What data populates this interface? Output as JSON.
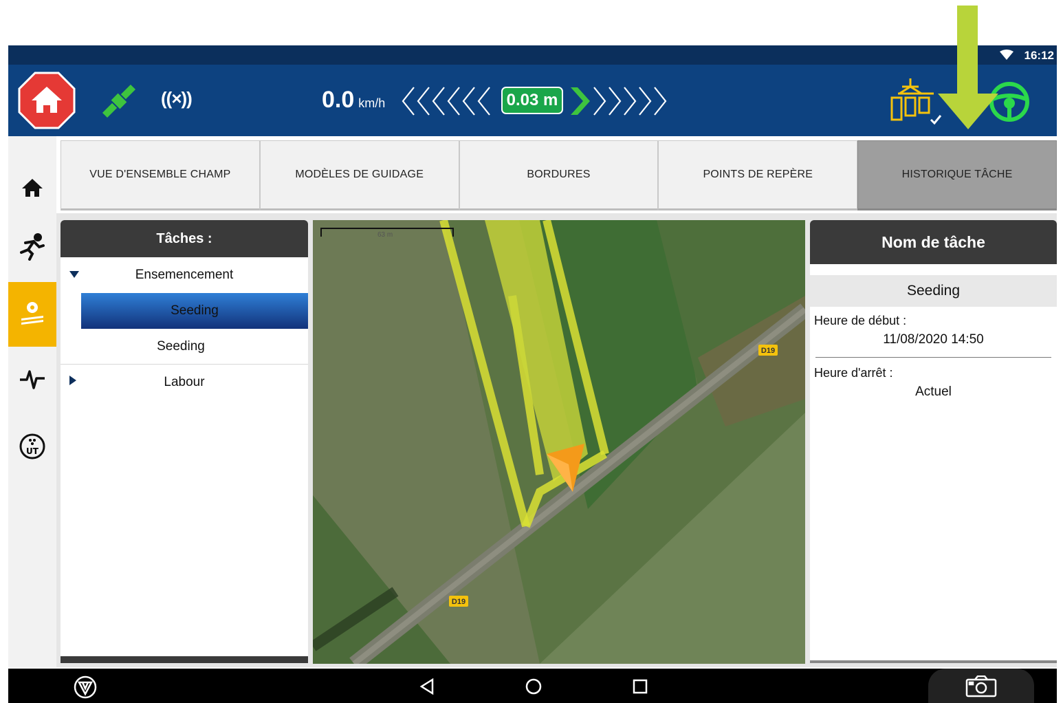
{
  "status": {
    "time": "16:12",
    "wifi_icon": "wifi-icon"
  },
  "toolbar": {
    "speed_value": "0.0",
    "speed_unit": "km/h",
    "offset": "0.03 m",
    "colors": {
      "bar": "#0d4280",
      "offset_bg": "#1aa64a",
      "stop": "#e53935",
      "gps": "#3ec43e",
      "steer": "#2bd94b",
      "implement": "#f4c20d"
    }
  },
  "sidebar": {
    "items": [
      {
        "icon": "home-icon"
      },
      {
        "icon": "runner-icon"
      },
      {
        "icon": "field-settings-icon",
        "active": true
      },
      {
        "icon": "activity-icon"
      },
      {
        "icon": "ut-icon"
      }
    ]
  },
  "tabs": [
    {
      "label": "VUE D'ENSEMBLE CHAMP"
    },
    {
      "label": "MODÈLES DE GUIDAGE"
    },
    {
      "label": "BORDURES"
    },
    {
      "label": "POINTS DE REPÈRE"
    },
    {
      "label": "HISTORIQUE TÂCHE",
      "active": true
    }
  ],
  "tasks": {
    "title": "Tâches :",
    "groups": [
      {
        "label": "Ensemencement",
        "expanded": true,
        "items": [
          "Seeding",
          "Seeding"
        ]
      },
      {
        "label": "Labour",
        "expanded": false
      }
    ]
  },
  "map": {
    "scale_label": "63 m",
    "road_labels": [
      "D19",
      "D19"
    ]
  },
  "detail": {
    "title": "Nom de tâche",
    "task_name": "Seeding",
    "start_label": "Heure de début :",
    "start_value": "11/08/2020 14:50",
    "stop_label": "Heure d'arrêt :",
    "stop_value": "Actuel"
  },
  "navbar": {
    "icons": [
      "trimble-icon",
      "back-icon",
      "home-circle-icon",
      "recents-icon",
      "screenshot-camera-icon"
    ]
  }
}
